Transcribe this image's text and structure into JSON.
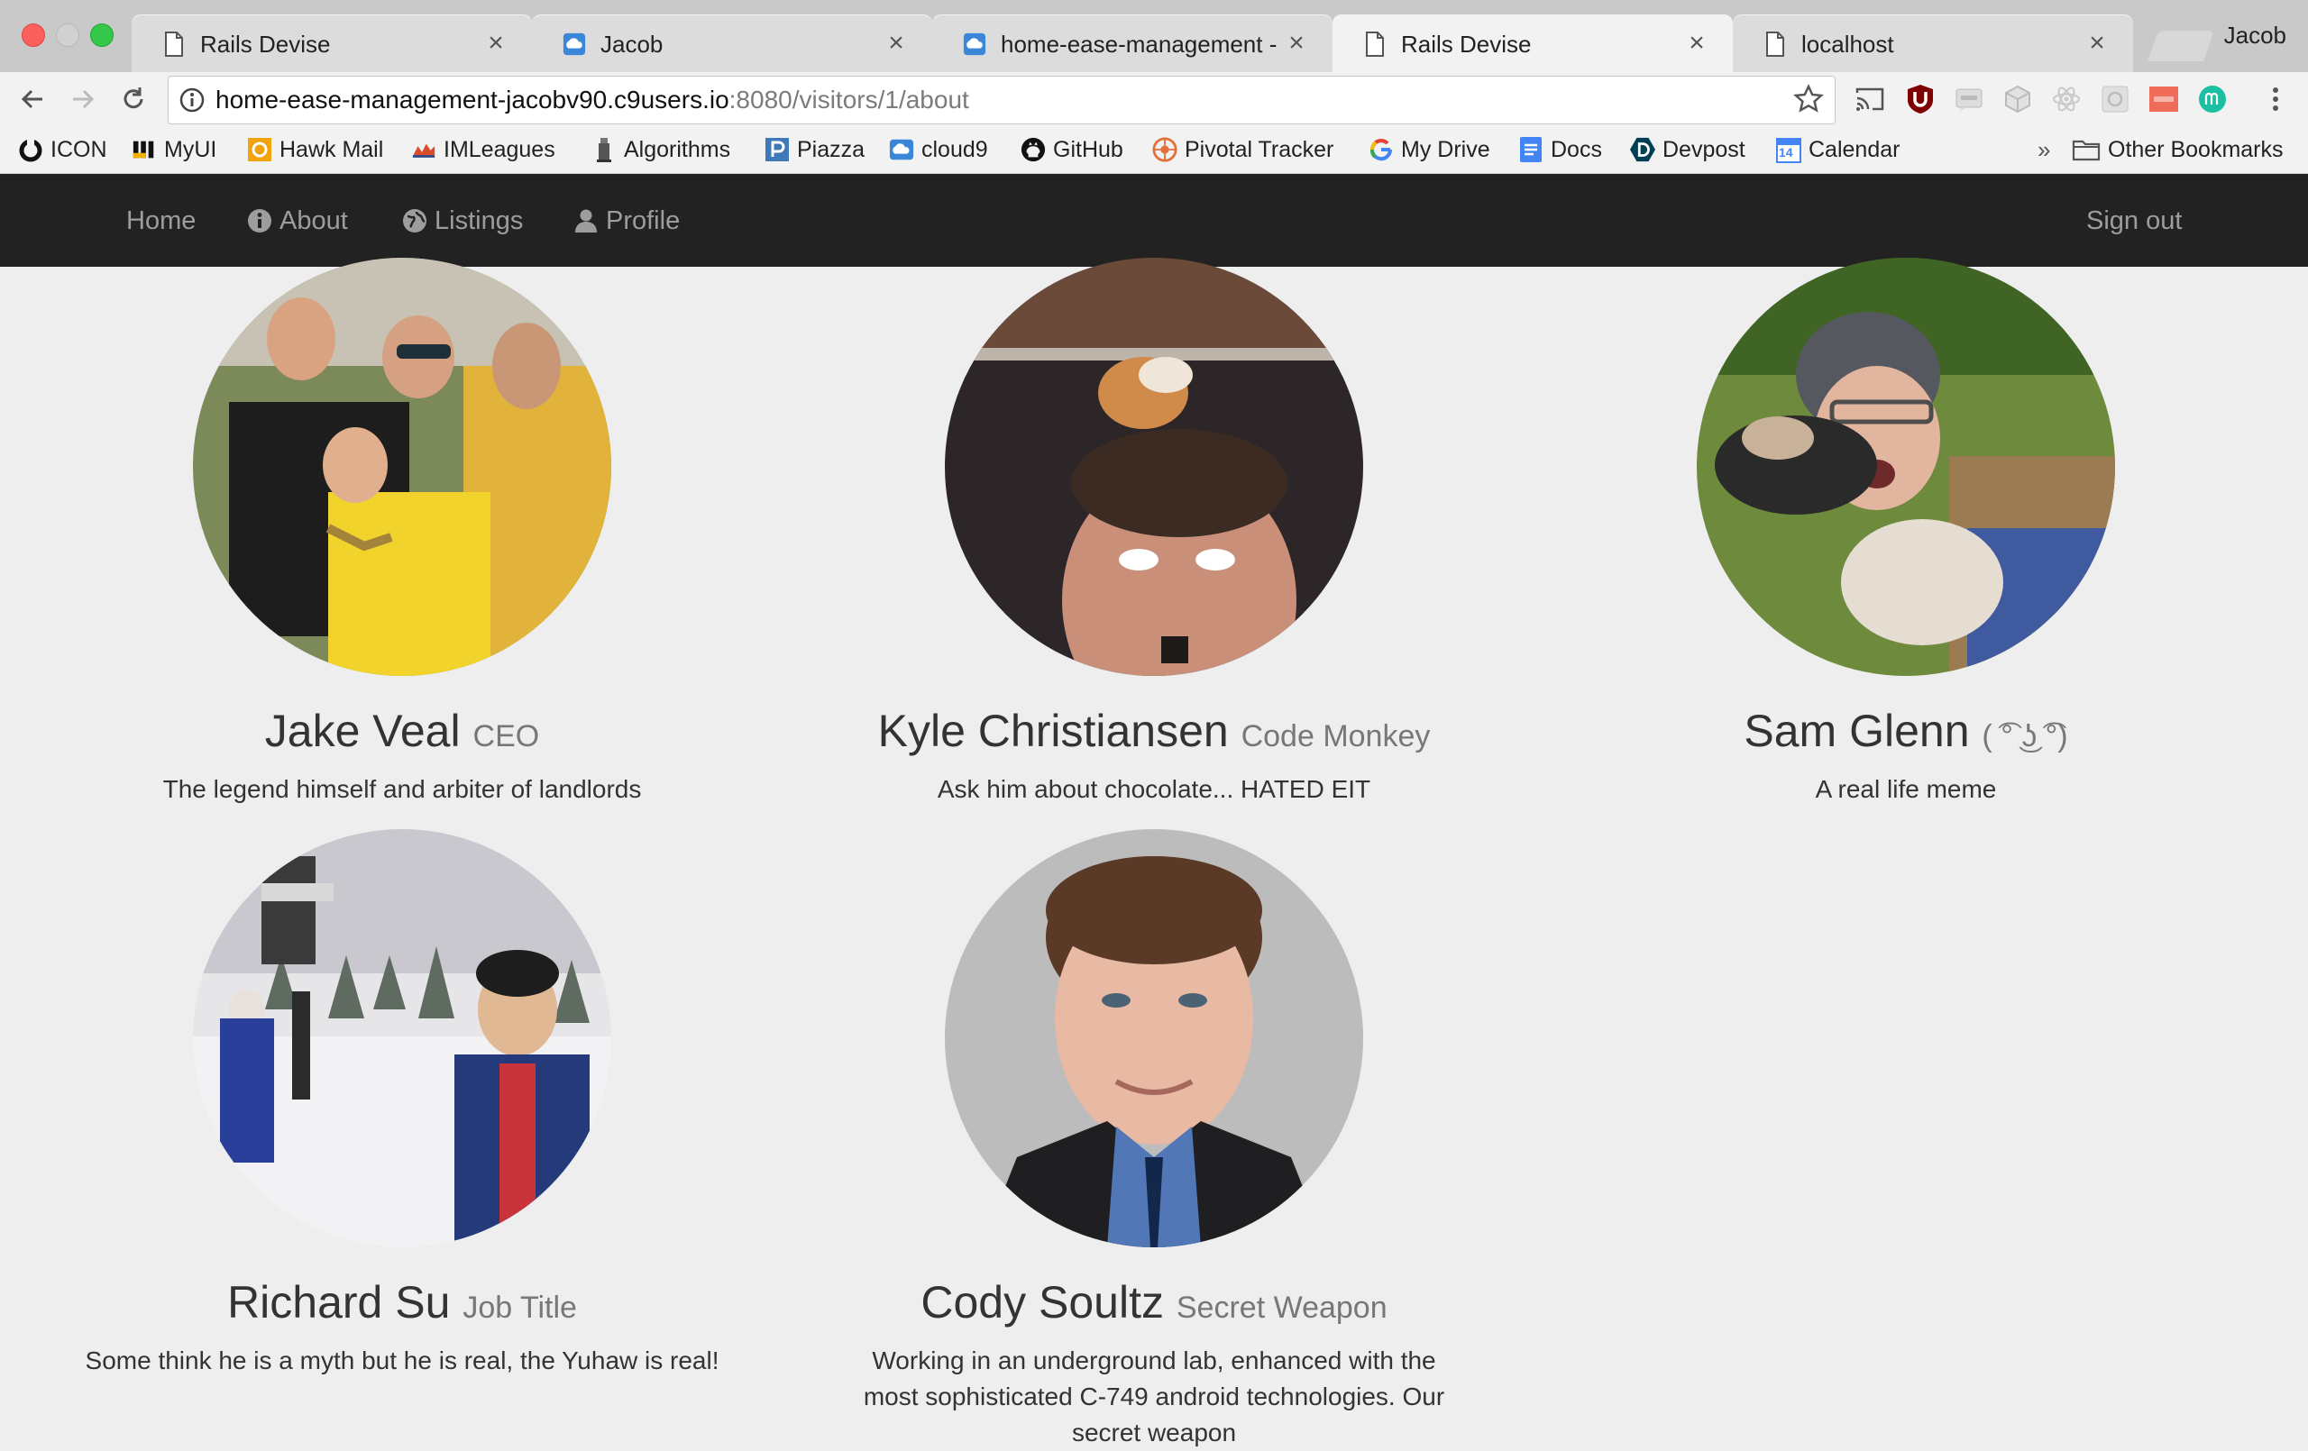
{
  "browser": {
    "tabs": [
      {
        "title": "Rails Devise",
        "icon": "page-icon",
        "active": false
      },
      {
        "title": "Jacob",
        "icon": "cloud9-icon",
        "active": false
      },
      {
        "title": "home-ease-management - Cl",
        "icon": "cloud9-icon",
        "active": false
      },
      {
        "title": "Rails Devise",
        "icon": "page-icon",
        "active": true
      },
      {
        "title": "localhost",
        "icon": "page-icon",
        "active": false
      }
    ],
    "tab_close_glyph": "×",
    "profile_name": "Jacob",
    "url_host": "home-ease-management-jacobv90.c9users.io",
    "url_rest": ":8080/visitors/1/about",
    "bookmarks": [
      {
        "label": "ICON",
        "icon": "icon-bookmark-icon"
      },
      {
        "label": "MyUI",
        "icon": "myui-icon"
      },
      {
        "label": "Hawk Mail",
        "icon": "hawk-mail-icon"
      },
      {
        "label": "IMLeagues",
        "icon": "imleagues-icon"
      },
      {
        "label": "Algorithms",
        "icon": "algorithms-icon"
      },
      {
        "label": "Piazza",
        "icon": "piazza-icon"
      },
      {
        "label": "cloud9",
        "icon": "cloud9-icon"
      },
      {
        "label": "GitHub",
        "icon": "github-icon"
      },
      {
        "label": "Pivotal Tracker",
        "icon": "pivotal-icon"
      },
      {
        "label": "My Drive",
        "icon": "google-icon"
      },
      {
        "label": "Docs",
        "icon": "docs-icon"
      },
      {
        "label": "Devpost",
        "icon": "devpost-icon"
      },
      {
        "label": "Calendar",
        "icon": "calendar-icon"
      }
    ],
    "bookmarks_overflow": "»",
    "other_bookmarks": "Other Bookmarks",
    "calendar_day": "14"
  },
  "navbar": {
    "home": "Home",
    "about": "About",
    "listings": "Listings",
    "profile": "Profile",
    "sign_out": "Sign out"
  },
  "team": [
    {
      "name": "Jake Veal",
      "role": "CEO",
      "description": "The legend himself and arbiter of landlords"
    },
    {
      "name": "Kyle Christiansen",
      "role": "Code Monkey",
      "description": "Ask him about chocolate... HATED EIT"
    },
    {
      "name": "Sam Glenn",
      "role": "( ͡° ͜ʖ ͡°)",
      "description": "A real life meme"
    },
    {
      "name": "Richard Su",
      "role": "Job Title",
      "description": "Some think he is a myth but he is real, the Yuhaw is real!"
    },
    {
      "name": "Cody Soultz",
      "role": "Secret Weapon",
      "description": "Working in an underground lab, enhanced with the most sophisticated C-749 android technologies. Our secret weapon"
    }
  ],
  "colors": {
    "navbar_bg": "#222222",
    "navbar_text": "#9d9d9d",
    "page_bg": "#eeeeee"
  }
}
